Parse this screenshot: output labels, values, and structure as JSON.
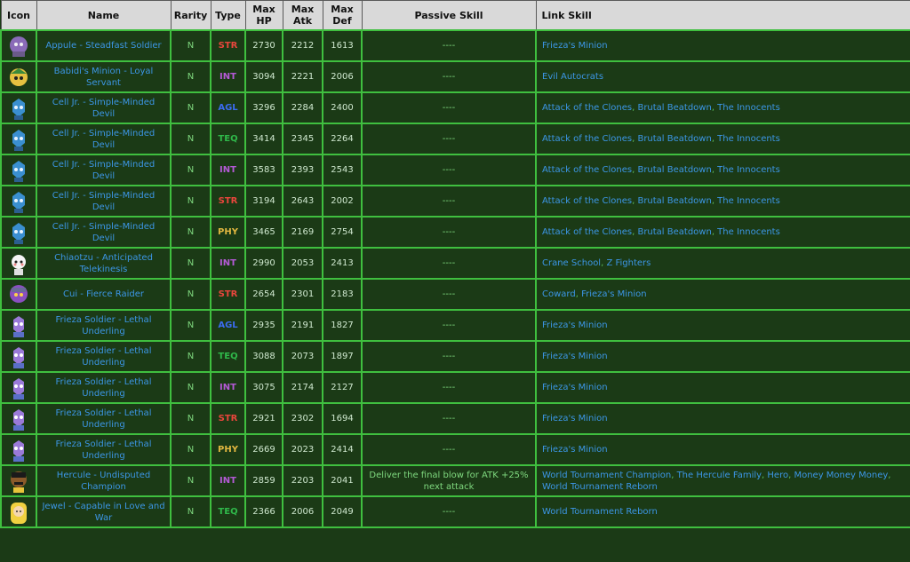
{
  "headers": {
    "icon": "Icon",
    "name": "Name",
    "rarity": "Rarity",
    "type": "Type",
    "hp": "Max HP",
    "atk": "Max Atk",
    "def": "Max Def",
    "passive": "Passive Skill",
    "link": "Link Skill"
  },
  "type_colors": {
    "STR": "#e8463c",
    "INT": "#b45ad6",
    "AGL": "#3b6bf0",
    "TEQ": "#2fb84a",
    "PHY": "#e0b640"
  },
  "rows": [
    {
      "icon": "appule-portrait-icon",
      "name": "Appule - Steadfast Soldier",
      "rarity": "N",
      "type": "STR",
      "hp": "2730",
      "atk": "2212",
      "def": "1613",
      "passive": "----",
      "links": [
        "Frieza's Minion"
      ]
    },
    {
      "icon": "babidi-minion-portrait-icon",
      "name": "Babidi's Minion - Loyal Servant",
      "rarity": "N",
      "type": "INT",
      "hp": "3094",
      "atk": "2221",
      "def": "2006",
      "passive": "----",
      "links": [
        "Evil Autocrats"
      ]
    },
    {
      "icon": "cell-jr-portrait-icon",
      "name": "Cell Jr. - Simple-Minded Devil",
      "rarity": "N",
      "type": "AGL",
      "hp": "3296",
      "atk": "2284",
      "def": "2400",
      "passive": "----",
      "links": [
        "Attack of the Clones",
        "Brutal Beatdown",
        "The Innocents"
      ]
    },
    {
      "icon": "cell-jr-portrait-icon",
      "name": "Cell Jr. - Simple-Minded Devil",
      "rarity": "N",
      "type": "TEQ",
      "hp": "3414",
      "atk": "2345",
      "def": "2264",
      "passive": "----",
      "links": [
        "Attack of the Clones",
        "Brutal Beatdown",
        "The Innocents"
      ]
    },
    {
      "icon": "cell-jr-portrait-icon",
      "name": "Cell Jr. - Simple-Minded Devil",
      "rarity": "N",
      "type": "INT",
      "hp": "3583",
      "atk": "2393",
      "def": "2543",
      "passive": "----",
      "links": [
        "Attack of the Clones",
        "Brutal Beatdown",
        "The Innocents"
      ]
    },
    {
      "icon": "cell-jr-portrait-icon",
      "name": "Cell Jr. - Simple-Minded Devil",
      "rarity": "N",
      "type": "STR",
      "hp": "3194",
      "atk": "2643",
      "def": "2002",
      "passive": "----",
      "links": [
        "Attack of the Clones",
        "Brutal Beatdown",
        "The Innocents"
      ]
    },
    {
      "icon": "cell-jr-portrait-icon",
      "name": "Cell Jr. - Simple-Minded Devil",
      "rarity": "N",
      "type": "PHY",
      "hp": "3465",
      "atk": "2169",
      "def": "2754",
      "passive": "----",
      "links": [
        "Attack of the Clones",
        "Brutal Beatdown",
        "The Innocents"
      ]
    },
    {
      "icon": "chiaotzu-portrait-icon",
      "name": "Chiaotzu - Anticipated Telekinesis",
      "rarity": "N",
      "type": "INT",
      "hp": "2990",
      "atk": "2053",
      "def": "2413",
      "passive": "----",
      "links": [
        "Crane School",
        "Z Fighters"
      ]
    },
    {
      "icon": "cui-portrait-icon",
      "name": "Cui - Fierce Raider",
      "rarity": "N",
      "type": "STR",
      "hp": "2654",
      "atk": "2301",
      "def": "2183",
      "passive": "----",
      "links": [
        "Coward",
        "Frieza's Minion"
      ]
    },
    {
      "icon": "frieza-soldier-portrait-icon",
      "name": "Frieza Soldier - Lethal Underling",
      "rarity": "N",
      "type": "AGL",
      "hp": "2935",
      "atk": "2191",
      "def": "1827",
      "passive": "----",
      "links": [
        "Frieza's Minion"
      ]
    },
    {
      "icon": "frieza-soldier-portrait-icon",
      "name": "Frieza Soldier - Lethal Underling",
      "rarity": "N",
      "type": "TEQ",
      "hp": "3088",
      "atk": "2073",
      "def": "1897",
      "passive": "----",
      "links": [
        "Frieza's Minion"
      ]
    },
    {
      "icon": "frieza-soldier-portrait-icon",
      "name": "Frieza Soldier - Lethal Underling",
      "rarity": "N",
      "type": "INT",
      "hp": "3075",
      "atk": "2174",
      "def": "2127",
      "passive": "----",
      "links": [
        "Frieza's Minion"
      ]
    },
    {
      "icon": "frieza-soldier-portrait-icon",
      "name": "Frieza Soldier - Lethal Underling",
      "rarity": "N",
      "type": "STR",
      "hp": "2921",
      "atk": "2302",
      "def": "1694",
      "passive": "----",
      "links": [
        "Frieza's Minion"
      ]
    },
    {
      "icon": "frieza-soldier-portrait-icon",
      "name": "Frieza Soldier - Lethal Underling",
      "rarity": "N",
      "type": "PHY",
      "hp": "2669",
      "atk": "2023",
      "def": "2414",
      "passive": "----",
      "links": [
        "Frieza's Minion"
      ]
    },
    {
      "icon": "hercule-portrait-icon",
      "name": "Hercule - Undisputed Champion",
      "rarity": "N",
      "type": "INT",
      "hp": "2859",
      "atk": "2203",
      "def": "2041",
      "passive": "Deliver the final blow for ATK +25% next attack",
      "links": [
        "World Tournament Champion",
        "The Hercule Family",
        "Hero",
        "Money Money Money",
        "World Tournament Reborn"
      ]
    },
    {
      "icon": "jewel-portrait-icon",
      "name": "Jewel - Capable in Love and War",
      "rarity": "N",
      "type": "TEQ",
      "hp": "2366",
      "atk": "2006",
      "def": "2049",
      "passive": "----",
      "links": [
        "World Tournament Reborn"
      ]
    }
  ]
}
